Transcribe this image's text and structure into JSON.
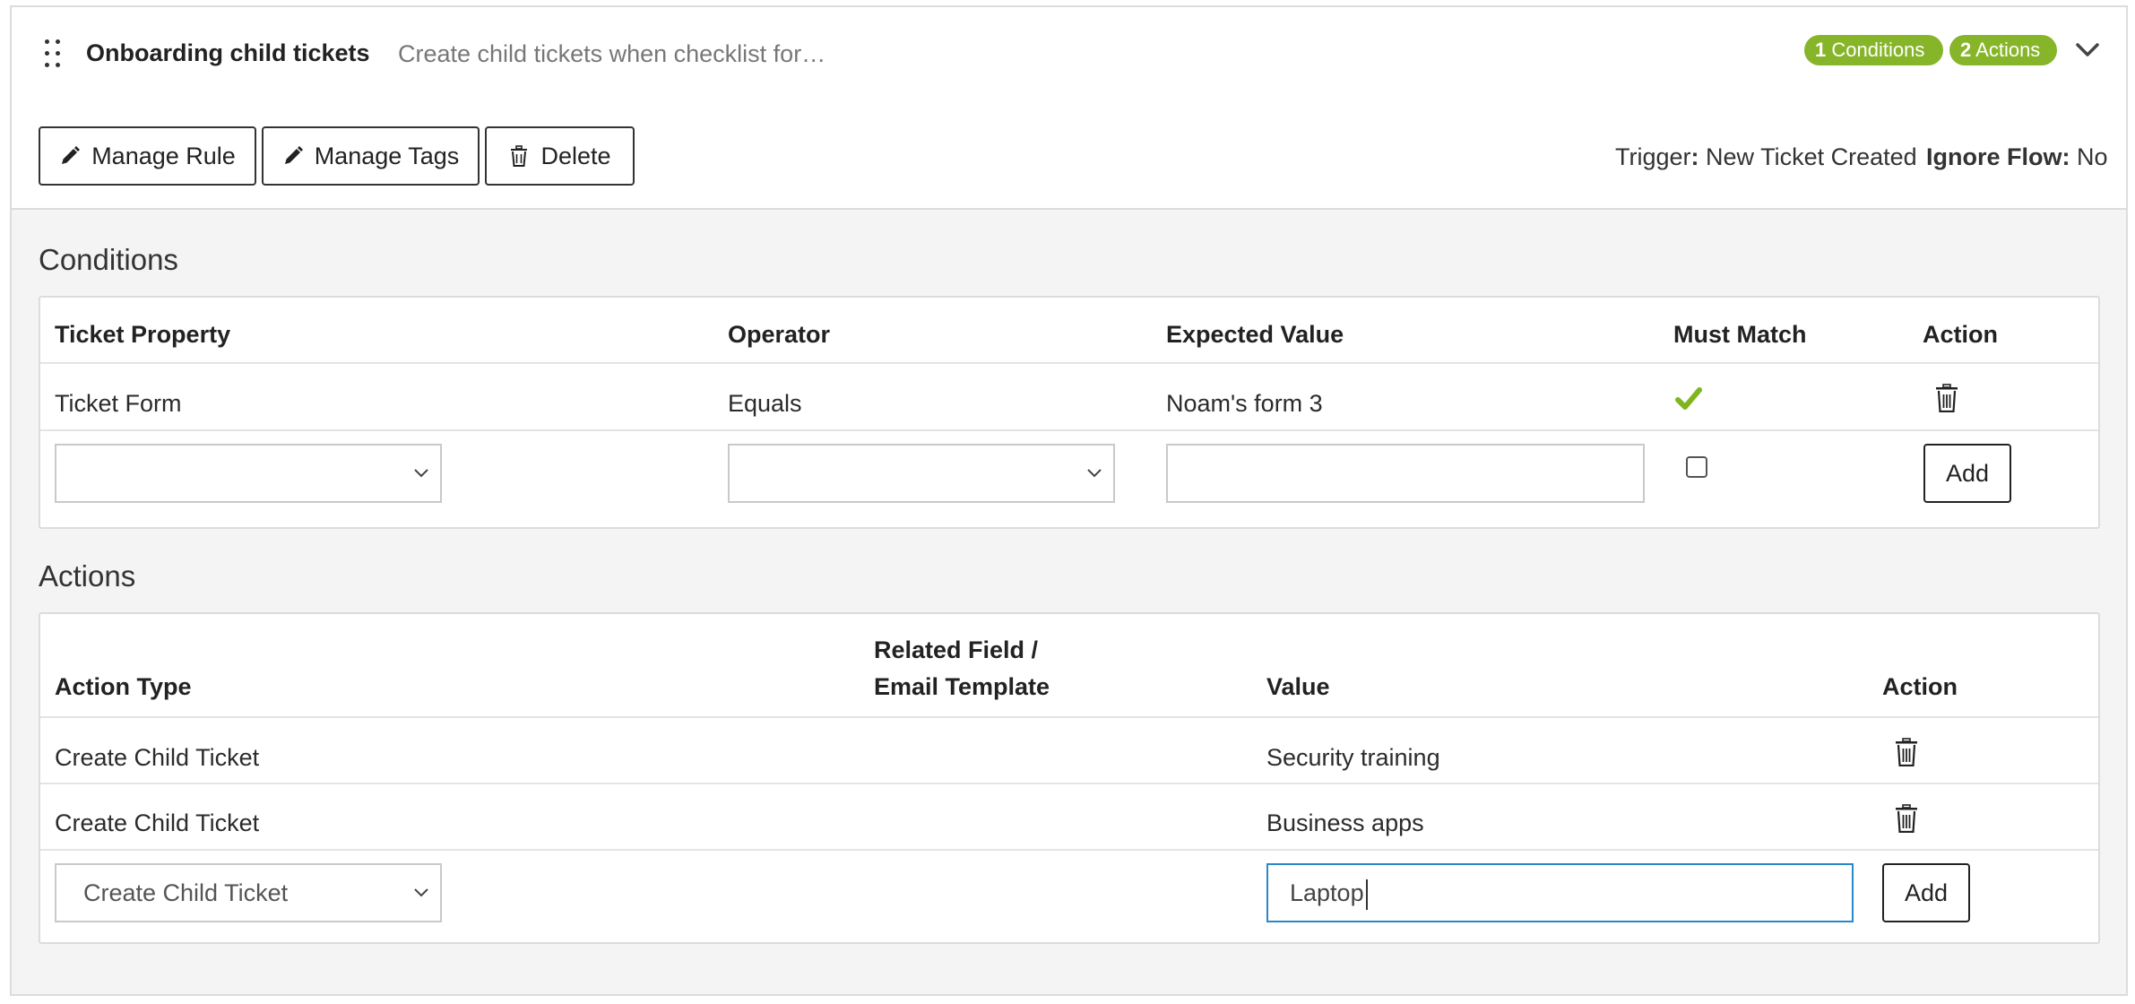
{
  "rule": {
    "title": "Onboarding child tickets",
    "description": "Create child tickets when checklist for…",
    "badges": {
      "conditions_count": "1",
      "conditions_label": "Conditions",
      "actions_count": "2",
      "actions_label": "Actions"
    }
  },
  "toolbar": {
    "manage_rule": "Manage Rule",
    "manage_tags": "Manage Tags",
    "delete": "Delete",
    "trigger_label": "Trigger",
    "trigger_colon": ":",
    "trigger_value": "New Ticket Created",
    "ignore_flow_label": "Ignore Flow:",
    "ignore_flow_value": "No"
  },
  "conditions": {
    "title": "Conditions",
    "headers": [
      "Ticket Property",
      "Operator",
      "Expected Value",
      "Must Match",
      "Action"
    ],
    "rows": [
      {
        "property": "Ticket Form",
        "operator": "Equals",
        "expected": "Noam's form 3",
        "must_match": true
      }
    ],
    "new_row": {
      "property": "",
      "operator": "",
      "expected": "",
      "must_match": false,
      "add_label": "Add"
    }
  },
  "actions": {
    "title": "Actions",
    "headers": {
      "action_type": "Action Type",
      "related_line1": "Related Field /",
      "related_line2": "Email Template",
      "value": "Value",
      "action": "Action"
    },
    "rows": [
      {
        "type": "Create Child Ticket",
        "related": "",
        "value": "Security training"
      },
      {
        "type": "Create Child Ticket",
        "related": "",
        "value": "Business apps"
      }
    ],
    "new_row": {
      "type": "Create Child Ticket",
      "value": "Laptop",
      "add_label": "Add"
    }
  },
  "colors": {
    "accent_green": "#87b52a",
    "focus_blue": "#2a87c8",
    "panel_bg": "#f4f4f4"
  },
  "icons": [
    "drag-handle-icon",
    "chevron-down-icon",
    "pencil-icon",
    "trash-icon",
    "checkmark-icon"
  ]
}
